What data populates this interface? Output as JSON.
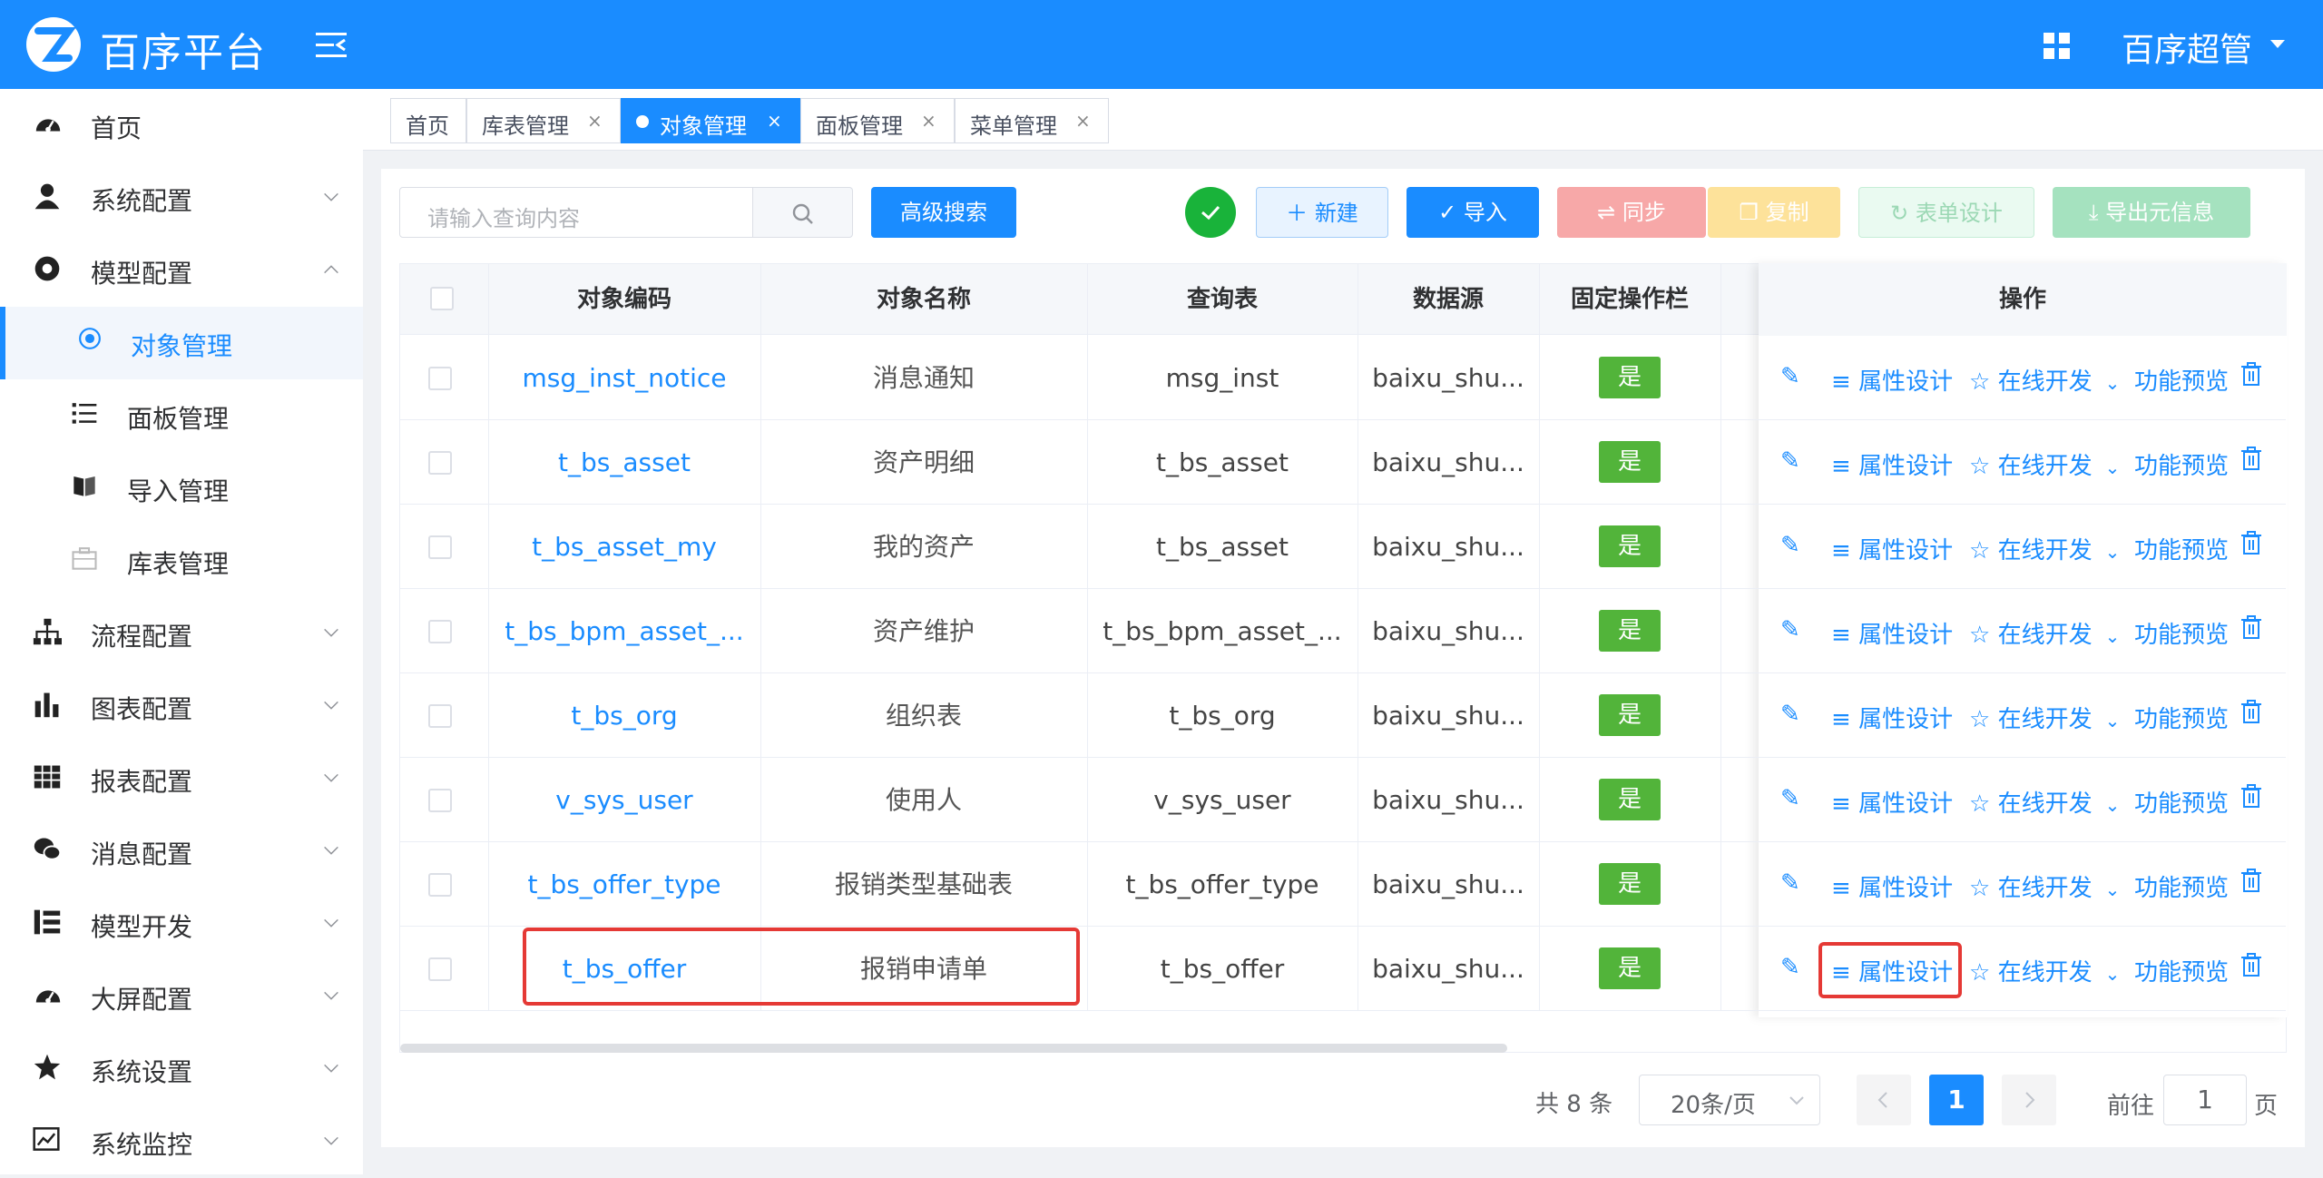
{
  "header": {
    "title": "百序平台",
    "user": "百序超管"
  },
  "sidebar": {
    "items": [
      {
        "label": "首页",
        "icon": "dashboard-icon",
        "expand": ""
      },
      {
        "label": "系统配置",
        "icon": "user-icon",
        "expand": "down"
      },
      {
        "label": "模型配置",
        "icon": "aperture-icon",
        "expand": "up"
      },
      {
        "label": "对象管理",
        "icon": "radio-dot-icon",
        "expand": "",
        "active": true,
        "sub": true
      },
      {
        "label": "面板管理",
        "icon": "list-icon",
        "expand": "",
        "sub": true
      },
      {
        "label": "导入管理",
        "icon": "book-icon",
        "expand": "",
        "sub": true
      },
      {
        "label": "库表管理",
        "icon": "toolbox-icon",
        "expand": "",
        "sub": true
      },
      {
        "label": "流程配置",
        "icon": "sitemap-icon",
        "expand": "down"
      },
      {
        "label": "图表配置",
        "icon": "bar-chart-icon",
        "expand": "down"
      },
      {
        "label": "报表配置",
        "icon": "grid-icon",
        "expand": "down"
      },
      {
        "label": "消息配置",
        "icon": "wechat-icon",
        "expand": "down"
      },
      {
        "label": "模型开发",
        "icon": "tree-icon",
        "expand": "down"
      },
      {
        "label": "大屏配置",
        "icon": "dashboard-icon",
        "expand": "down"
      },
      {
        "label": "系统设置",
        "icon": "star-icon",
        "expand": "down"
      },
      {
        "label": "系统监控",
        "icon": "monitor-chart-icon",
        "expand": "down"
      }
    ]
  },
  "tabs": [
    {
      "label": "首页",
      "closable": false
    },
    {
      "label": "库表管理",
      "closable": true
    },
    {
      "label": "对象管理",
      "closable": true,
      "active": true
    },
    {
      "label": "面板管理",
      "closable": true
    },
    {
      "label": "菜单管理",
      "closable": true
    }
  ],
  "toolbar": {
    "search_placeholder": "请输入查询内容",
    "advanced_search": "高级搜索",
    "new": "新建",
    "import": "导入",
    "sync": "同步",
    "copy": "复制",
    "form_design": "表单设计",
    "export_meta": "导出元信息"
  },
  "table": {
    "headers": [
      "对象编码",
      "对象名称",
      "查询表",
      "数据源",
      "固定操作栏",
      "操作"
    ],
    "rows": [
      {
        "code": "msg_inst_notice",
        "name": "消息通知",
        "query": "msg_inst",
        "ds": "baixu_shu...",
        "fixed": "是"
      },
      {
        "code": "t_bs_asset",
        "name": "资产明细",
        "query": "t_bs_asset",
        "ds": "baixu_shu...",
        "fixed": "是"
      },
      {
        "code": "t_bs_asset_my",
        "name": "我的资产",
        "query": "t_bs_asset",
        "ds": "baixu_shu...",
        "fixed": "是"
      },
      {
        "code": "t_bs_bpm_asset_...",
        "name": "资产维护",
        "query": "t_bs_bpm_asset_...",
        "ds": "baixu_shu...",
        "fixed": "是"
      },
      {
        "code": "t_bs_org",
        "name": "组织表",
        "query": "t_bs_org",
        "ds": "baixu_shu...",
        "fixed": "是"
      },
      {
        "code": "v_sys_user",
        "name": "使用人",
        "query": "v_sys_user",
        "ds": "baixu_shu...",
        "fixed": "是"
      },
      {
        "code": "t_bs_offer_type",
        "name": "报销类型基础表",
        "query": "t_bs_offer_type",
        "ds": "baixu_shu...",
        "fixed": "是"
      },
      {
        "code": "t_bs_offer",
        "name": "报销申请单",
        "query": "t_bs_offer",
        "ds": "baixu_shu...",
        "fixed": "是"
      }
    ],
    "actions": {
      "attr": "属性设计",
      "dev": "在线开发",
      "preview": "功能预览"
    }
  },
  "pagination": {
    "total": "共 8 条",
    "page_size": "20条/页",
    "current": "1",
    "goto_prefix": "前往",
    "goto_value": "1",
    "goto_suffix": "页"
  },
  "colors": {
    "accent": "#1a8cff",
    "yes": "#52b43a",
    "highlight": "#e53935"
  }
}
